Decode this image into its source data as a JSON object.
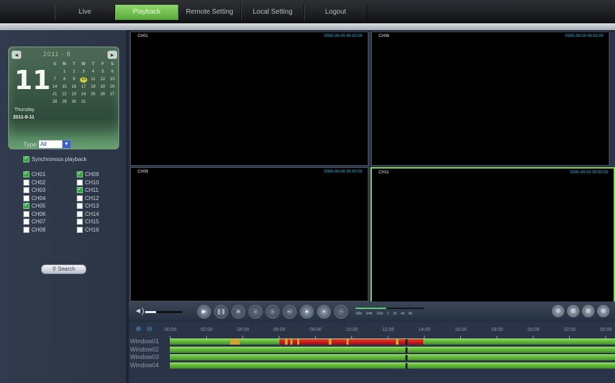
{
  "nav": {
    "live": "Live",
    "playback": "Playback",
    "remote": "Remote Setting",
    "local": "Local Setting",
    "logout": "Logout"
  },
  "calendar": {
    "month_label": "2011 - 8",
    "prev": "◂",
    "next": "▸",
    "big_day": "11",
    "weekday": "Thursday",
    "date": "2011-8-11",
    "headers": [
      "S",
      "M",
      "T",
      "W",
      "T",
      "F",
      "S"
    ],
    "weeks": [
      [
        "",
        "1",
        "2",
        "3",
        "4",
        "5",
        "6"
      ],
      [
        "7",
        "8",
        "9",
        "10",
        "11",
        "12",
        "13"
      ],
      [
        "14",
        "15",
        "16",
        "17",
        "18",
        "19",
        "20"
      ],
      [
        "21",
        "22",
        "23",
        "24",
        "25",
        "26",
        "27"
      ],
      [
        "28",
        "29",
        "30",
        "31",
        "",
        "",
        ""
      ]
    ],
    "selected": "10"
  },
  "type": {
    "label": "Type",
    "value": "All"
  },
  "sync": {
    "label": "Synchronous playback",
    "checked": true
  },
  "channels": [
    {
      "label": "CH01",
      "checked": true
    },
    {
      "label": "CH02",
      "checked": false
    },
    {
      "label": "CH03",
      "checked": false
    },
    {
      "label": "CH04",
      "checked": false
    },
    {
      "label": "CH05",
      "checked": true
    },
    {
      "label": "CH06",
      "checked": false
    },
    {
      "label": "CH07",
      "checked": false
    },
    {
      "label": "CH08",
      "checked": false
    },
    {
      "label": "CH09",
      "checked": true
    },
    {
      "label": "CH10",
      "checked": false
    },
    {
      "label": "CH11",
      "checked": true
    },
    {
      "label": "CH12",
      "checked": false
    },
    {
      "label": "CH13",
      "checked": false
    },
    {
      "label": "CH14",
      "checked": false
    },
    {
      "label": "CH15",
      "checked": false
    },
    {
      "label": "CH16",
      "checked": false
    }
  ],
  "search": {
    "label": "Search",
    "icon": "magnifier-icon"
  },
  "videos": {
    "ch01": {
      "label": "CH01",
      "time": "0000-00-00 00:00:00"
    },
    "ch06": {
      "label": "CH06",
      "time": "0000-00-00 00:00:00"
    },
    "ch09": {
      "label": "CH09",
      "time": "0000-00-00 00:00:00"
    },
    "ch11": {
      "label": "CH11",
      "time": "0000-00-00 00:00:00"
    }
  },
  "controls": {
    "volume_level": 0.3,
    "speed_labels": [
      "1/8x",
      "1/4x",
      "1/2x",
      "1",
      "2x",
      "4x",
      "8x"
    ],
    "speed_level": 0.45
  },
  "timeline": {
    "hours": [
      "00:00",
      "02:00",
      "04:00",
      "06:00",
      "08:00",
      "10:00",
      "12:00",
      "14:00",
      "16:00",
      "18:00",
      "20:00",
      "22:00",
      "00:00"
    ],
    "tracks": [
      "Window01",
      "Window02",
      "Window03",
      "Window04"
    ]
  },
  "colors": {
    "accent": "#58a83a",
    "record_normal": "#5fb23b",
    "record_alarm": "#d21d1d",
    "timestamp": "#35b9d8"
  }
}
